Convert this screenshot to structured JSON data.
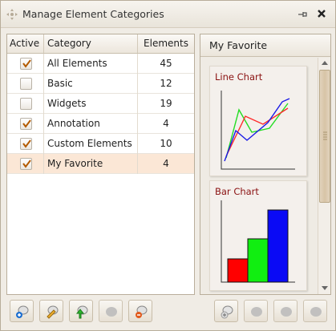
{
  "window": {
    "title": "Manage Element Categories"
  },
  "table": {
    "headers": {
      "active": "Active",
      "category": "Category",
      "elements": "Elements"
    },
    "rows": [
      {
        "active": true,
        "category": "All Elements",
        "elements": "45"
      },
      {
        "active": false,
        "category": "Basic",
        "elements": "12"
      },
      {
        "active": false,
        "category": "Widgets",
        "elements": "19"
      },
      {
        "active": true,
        "category": "Annotation",
        "elements": "4"
      },
      {
        "active": true,
        "category": "Custom Elements",
        "elements": "10"
      },
      {
        "active": true,
        "category": "My Favorite",
        "elements": "4"
      }
    ],
    "selected_index": 5
  },
  "favorites": {
    "title": "My Favorite",
    "items": [
      {
        "label": "Line Chart",
        "icon": "line-chart-thumbnail"
      },
      {
        "label": "Bar Chart",
        "icon": "bar-chart-thumbnail"
      }
    ]
  },
  "toolbar_left": [
    {
      "icon": "add-category-icon"
    },
    {
      "icon": "edit-category-icon"
    },
    {
      "icon": "import-category-icon"
    },
    {
      "icon": "category-disabled-icon"
    },
    {
      "icon": "remove-category-icon"
    }
  ],
  "toolbar_right": [
    {
      "icon": "add-element-icon"
    },
    {
      "icon": "element-disabled-icon"
    },
    {
      "icon": "element-disabled-icon"
    },
    {
      "icon": "element-disabled-icon"
    }
  ],
  "colors": {
    "accent_label": "#8a1111",
    "selected_row": "#fbe7d6",
    "series_red": "#ff2a2a",
    "series_green": "#22dd22",
    "series_blue": "#1a1ae6"
  }
}
